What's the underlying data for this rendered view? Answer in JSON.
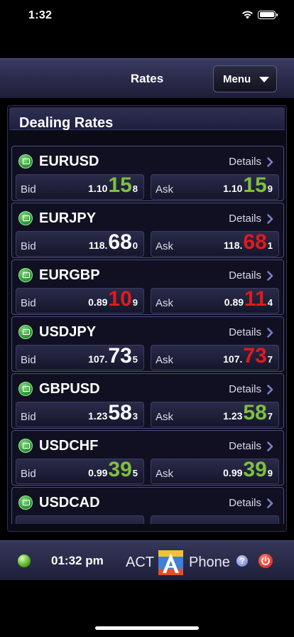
{
  "status_bar": {
    "time": "1:32"
  },
  "nav": {
    "title": "Rates",
    "menu_label": "Menu"
  },
  "panel": {
    "title": "Dealing Rates"
  },
  "labels": {
    "bid": "Bid",
    "ask": "Ask",
    "details": "Details"
  },
  "rates": [
    {
      "symbol": "EURUSD",
      "bid": {
        "prefix": "1.10",
        "big": "15",
        "pip": "8",
        "trend": "up"
      },
      "ask": {
        "prefix": "1.10",
        "big": "15",
        "pip": "9",
        "trend": "up"
      }
    },
    {
      "symbol": "EURJPY",
      "bid": {
        "prefix": "118.",
        "big": "68",
        "pip": "0",
        "trend": "same"
      },
      "ask": {
        "prefix": "118.",
        "big": "68",
        "pip": "1",
        "trend": "down"
      }
    },
    {
      "symbol": "EURGBP",
      "bid": {
        "prefix": "0.89",
        "big": "10",
        "pip": "9",
        "trend": "down"
      },
      "ask": {
        "prefix": "0.89",
        "big": "11",
        "pip": "4",
        "trend": "down"
      }
    },
    {
      "symbol": "USDJPY",
      "bid": {
        "prefix": "107.",
        "big": "73",
        "pip": "5",
        "trend": "same"
      },
      "ask": {
        "prefix": "107.",
        "big": "73",
        "pip": "7",
        "trend": "down"
      }
    },
    {
      "symbol": "GBPUSD",
      "bid": {
        "prefix": "1.23",
        "big": "58",
        "pip": "3",
        "trend": "same"
      },
      "ask": {
        "prefix": "1.23",
        "big": "58",
        "pip": "7",
        "trend": "up"
      }
    },
    {
      "symbol": "USDCHF",
      "bid": {
        "prefix": "0.99",
        "big": "39",
        "pip": "5",
        "trend": "up"
      },
      "ask": {
        "prefix": "0.99",
        "big": "39",
        "pip": "9",
        "trend": "up"
      }
    },
    {
      "symbol": "USDCAD",
      "bid": {
        "prefix": "",
        "big": "",
        "pip": "",
        "trend": "same"
      },
      "ask": {
        "prefix": "",
        "big": "",
        "pip": "",
        "trend": "same"
      }
    }
  ],
  "footer": {
    "time": "01:32 pm",
    "brand_left": "ACT",
    "brand_right": "Phone",
    "help_glyph": "?"
  },
  "colors": {
    "up": "#7fc03e",
    "down": "#e21a1a",
    "same": "#ffffff",
    "nav": "#2c2d4e"
  },
  "icons": [
    "wifi-icon",
    "battery-icon",
    "chevron-down-icon",
    "chevron-right-icon",
    "status-icon",
    "connection-status-icon",
    "act-logo-icon",
    "help-icon",
    "power-icon"
  ]
}
